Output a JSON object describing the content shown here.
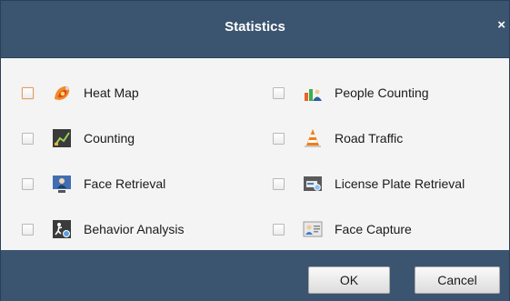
{
  "dialog": {
    "title": "Statistics",
    "close_glyph": "×"
  },
  "options": [
    {
      "label": "Heat Map",
      "icon": "heat-map-icon",
      "checked": false
    },
    {
      "label": "People Counting",
      "icon": "people-counting-icon",
      "checked": false
    },
    {
      "label": "Counting",
      "icon": "counting-icon",
      "checked": false
    },
    {
      "label": "Road Traffic",
      "icon": "road-traffic-icon",
      "checked": false
    },
    {
      "label": "Face Retrieval",
      "icon": "face-retrieval-icon",
      "checked": false
    },
    {
      "label": "License Plate Retrieval",
      "icon": "license-plate-retrieval-icon",
      "checked": false
    },
    {
      "label": "Behavior Analysis",
      "icon": "behavior-analysis-icon",
      "checked": false
    },
    {
      "label": "Face Capture",
      "icon": "face-capture-icon",
      "checked": false
    }
  ],
  "buttons": {
    "ok": "OK",
    "cancel": "Cancel"
  },
  "colors": {
    "titlebar": "#3b5470",
    "content_bg": "#f4f4f4",
    "focus_ring": "#e0a060"
  }
}
